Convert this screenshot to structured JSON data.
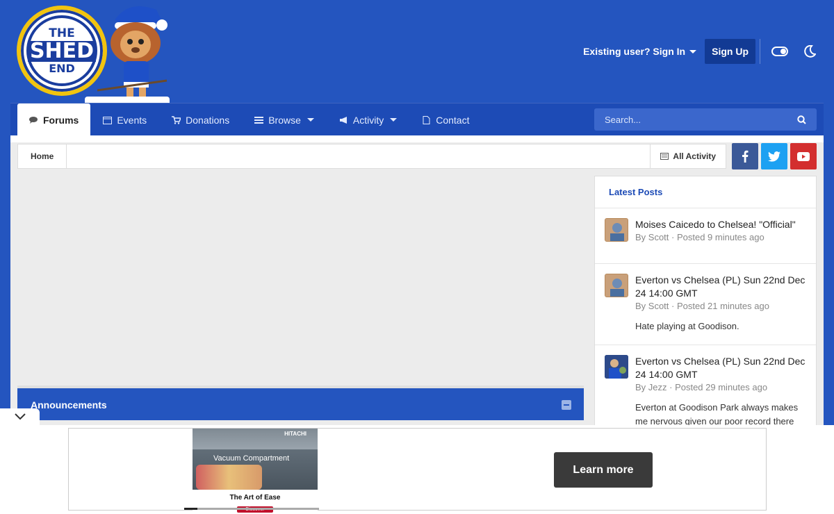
{
  "brand": {
    "logo_line1": "THE",
    "logo_line2": "SHED",
    "logo_line3": "END"
  },
  "user_bar": {
    "signin_label": "Existing user? Sign In",
    "signup_label": "Sign Up"
  },
  "nav": {
    "tabs": [
      {
        "label": "Forums",
        "icon": "comments-icon",
        "active": true
      },
      {
        "label": "Events",
        "icon": "calendar-icon"
      },
      {
        "label": "Donations",
        "icon": "cart-icon"
      },
      {
        "label": "Browse",
        "icon": "list-icon",
        "dropdown": true
      },
      {
        "label": "Activity",
        "icon": "megaphone-icon",
        "dropdown": true
      },
      {
        "label": "Contact",
        "icon": "document-icon"
      }
    ],
    "search_placeholder": "Search..."
  },
  "breadcrumb": {
    "home": "Home",
    "all_activity": "All Activity"
  },
  "social": {
    "facebook_color": "#3b5998",
    "twitter_color": "#1da1f2",
    "youtube_color": "#d32f2f"
  },
  "announcements": {
    "title": "Announcements"
  },
  "sidebar": {
    "title": "Latest Posts",
    "posts": [
      {
        "title": "Moises Caicedo to Chelsea! \"Official\"",
        "meta": "By Scott · Posted 9 minutes ago",
        "snippet": ""
      },
      {
        "title": "Everton vs Chelsea (PL) Sun 22nd Dec 24 14:00 GMT",
        "meta": "By Scott · Posted 21 minutes ago",
        "snippet": "Hate playing at Goodison."
      },
      {
        "title": "Everton vs Chelsea (PL) Sun 22nd Dec 24 14:00 GMT",
        "meta": "By Jezz · Posted 29 minutes ago",
        "snippet": "Everton at Goodison Park always makes me nervous given our poor record there over"
      }
    ]
  },
  "ad": {
    "brand": "HITACHI",
    "headline": "Vacuum Compartment",
    "caption": "The Art of Ease",
    "discover": "Discover",
    "cta": "Learn more",
    "progress": 0.1
  },
  "colors": {
    "page_bg": "#2455bf",
    "nav_bg": "#1d4bb6",
    "accent": "#1d4bb6"
  }
}
